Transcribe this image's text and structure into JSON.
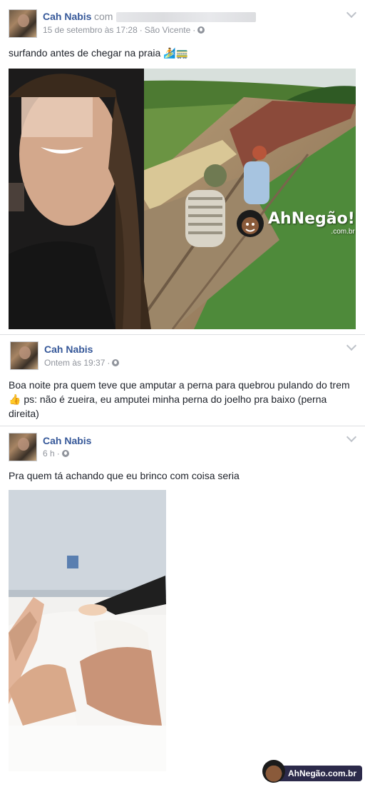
{
  "posts": [
    {
      "author": "Cah Nabis",
      "with_word": "com",
      "timestamp": "15 de setembro às 17:28",
      "location": "São Vicente",
      "separator": "·",
      "text": "surfando antes de chegar na praia 🏄🚃",
      "photo_watermark": "AhNegão!",
      "photo_watermark_sub": ".com.br"
    },
    {
      "author": "Cah Nabis",
      "timestamp": "Ontem às 19:37",
      "separator": "·",
      "text": "Boa noite pra quem teve que amputar a perna para quebrou pulando do trem👍 ps: não é zueira, eu amputei minha perna do joelho pra baixo (perna direita)"
    },
    {
      "author": "Cah Nabis",
      "timestamp": "6 h",
      "separator": "·",
      "text": "Pra quem tá achando que eu brinco com coisa seria"
    }
  ],
  "brand_badge": "AhNegão.com.br",
  "icons": {
    "privacy": "globe-icon",
    "menu": "chevron-down-icon"
  },
  "colors": {
    "name_link": "#365899",
    "meta_gray": "#90949c",
    "body_text": "#1d2129",
    "feed_bg": "#e9ebee"
  }
}
